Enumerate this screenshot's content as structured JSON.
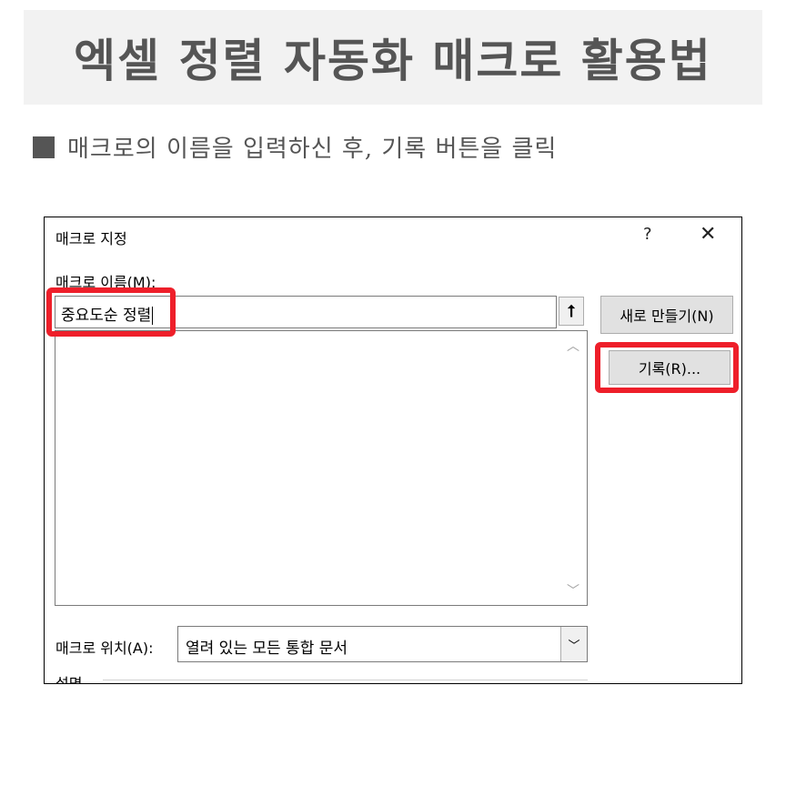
{
  "banner": {
    "title": "엑셀 정렬 자동화 매크로 활용법"
  },
  "subtitle": {
    "text": "매크로의 이름을 입력하신 후, 기록 버튼을 클릭"
  },
  "dialog": {
    "title": "매크로 지정",
    "help": "?",
    "close": "✕",
    "name_label": "매크로 이름(M):",
    "name_value": "중요도순 정렬",
    "new_button": "새로 만들기(N)",
    "record_button": "기록(R)...",
    "location_label": "매크로 위치(A):",
    "location_value": "열려 있는 모든 통합 문서",
    "description_label": "설명"
  },
  "highlight_color": "#ee1f2a"
}
